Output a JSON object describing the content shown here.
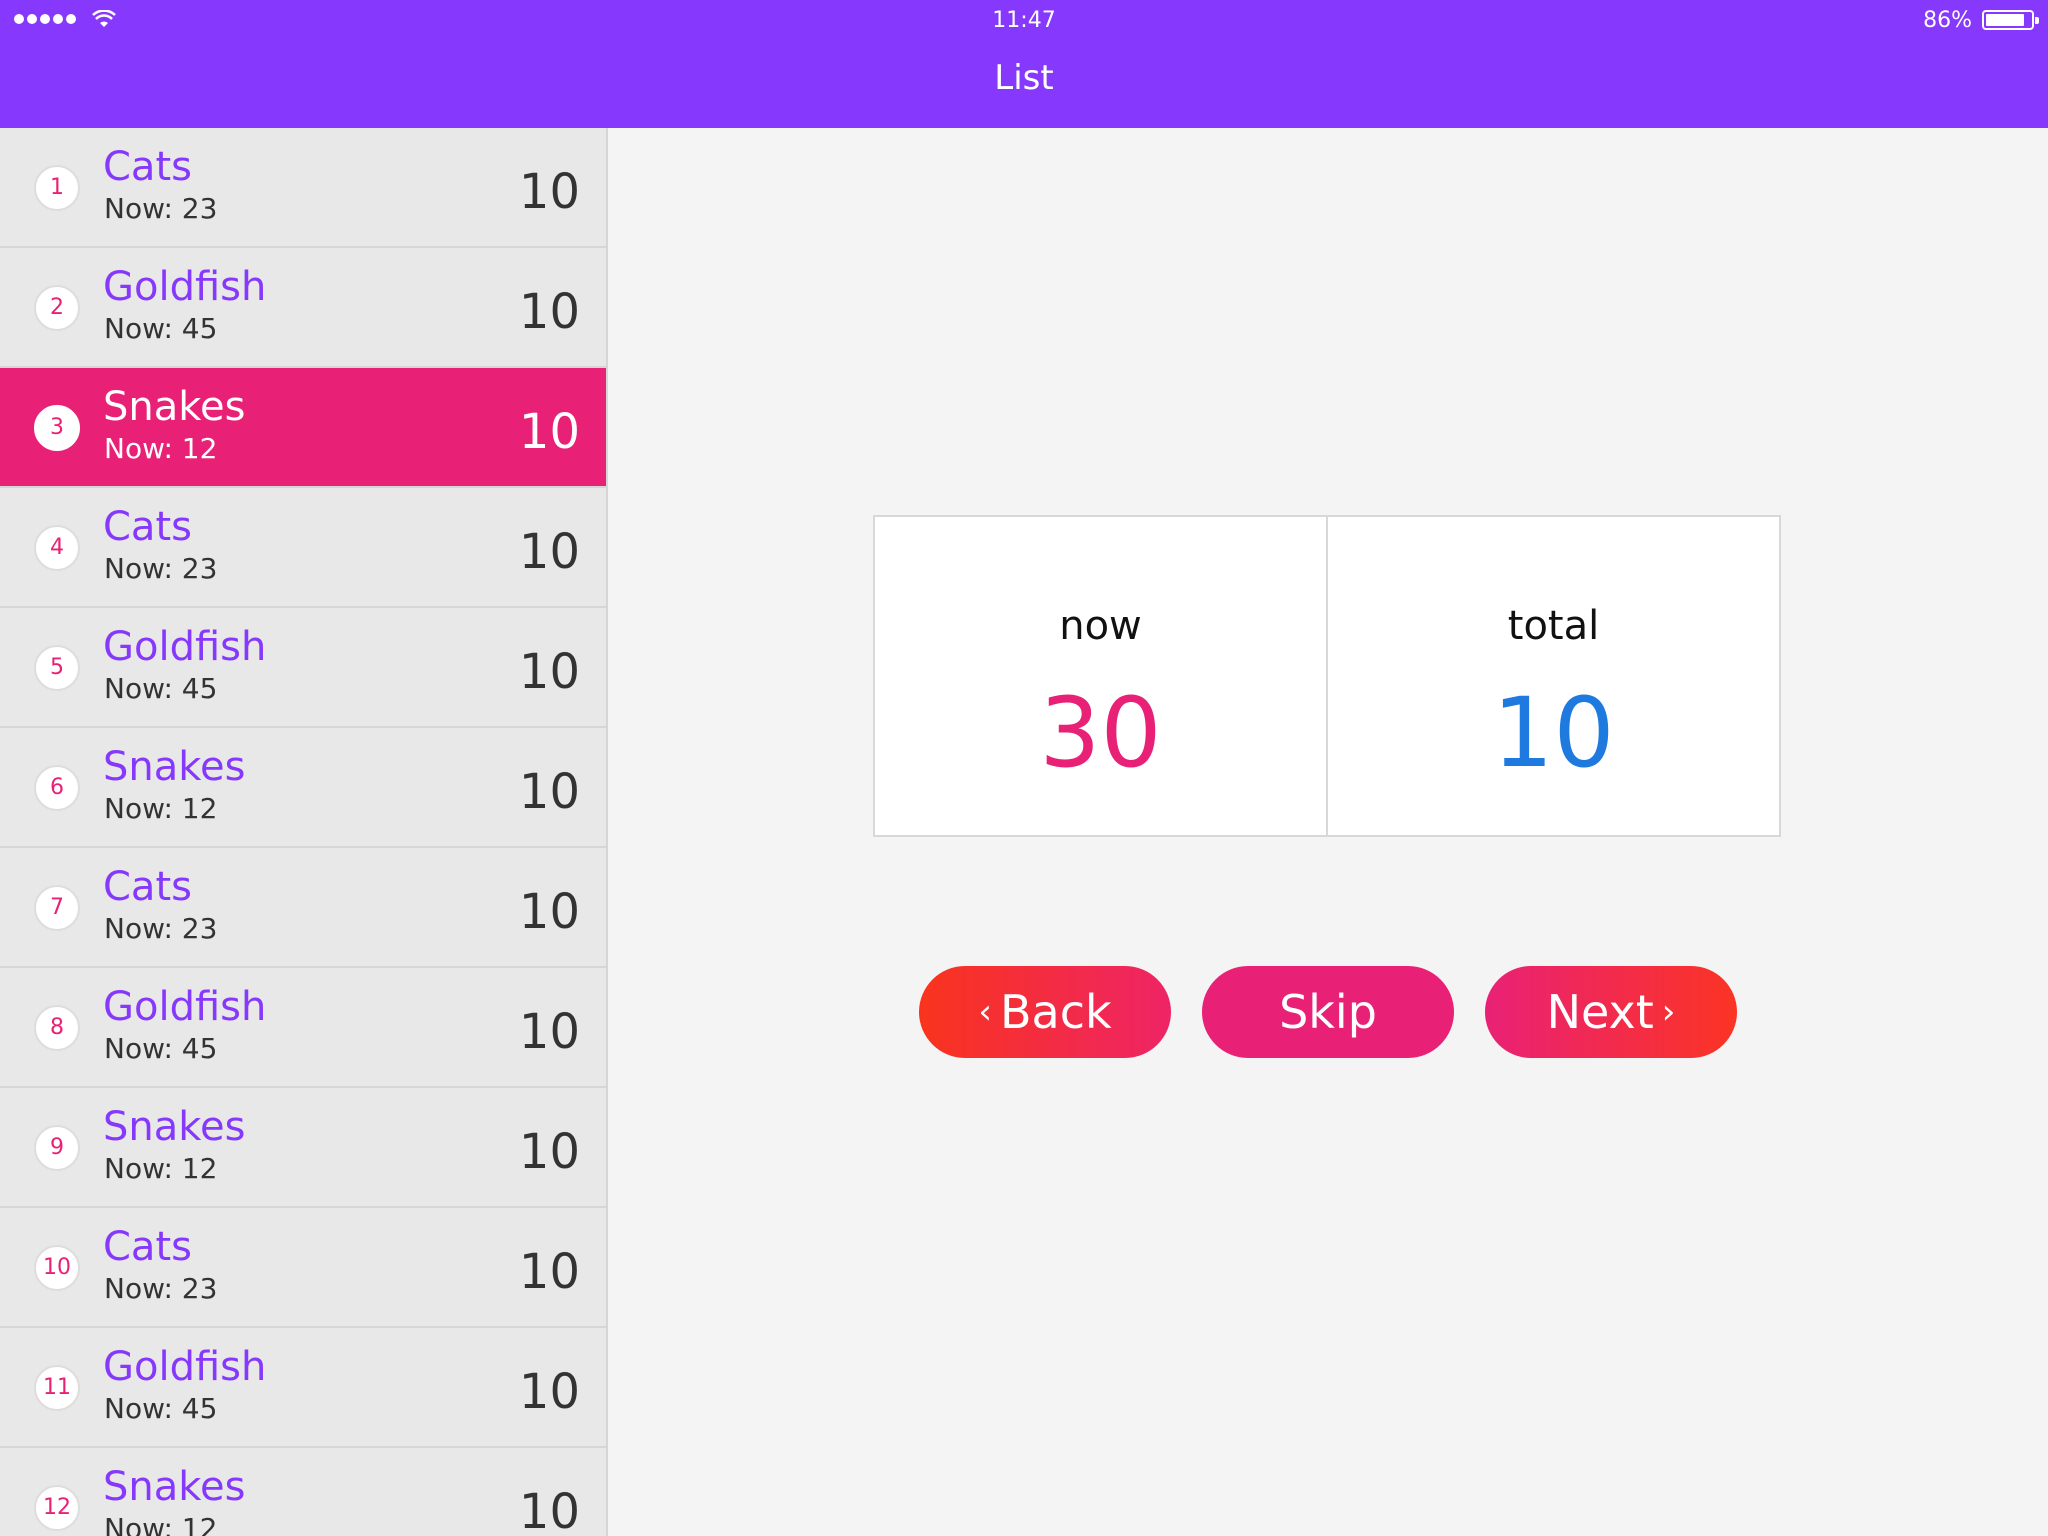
{
  "status": {
    "time": "11:47",
    "battery": "86%",
    "battery_level": 0.86
  },
  "nav": {
    "title": "List"
  },
  "list": [
    {
      "index": "1",
      "title": "Cats",
      "sub": "Now: 23",
      "value": "10"
    },
    {
      "index": "2",
      "title": "Goldfish",
      "sub": "Now: 45",
      "value": "10"
    },
    {
      "index": "3",
      "title": "Snakes",
      "sub": "Now: 12",
      "value": "10",
      "selected": true
    },
    {
      "index": "4",
      "title": "Cats",
      "sub": "Now: 23",
      "value": "10"
    },
    {
      "index": "5",
      "title": "Goldfish",
      "sub": "Now: 45",
      "value": "10"
    },
    {
      "index": "6",
      "title": "Snakes",
      "sub": "Now: 12",
      "value": "10"
    },
    {
      "index": "7",
      "title": "Cats",
      "sub": "Now: 23",
      "value": "10"
    },
    {
      "index": "8",
      "title": "Goldfish",
      "sub": "Now: 45",
      "value": "10"
    },
    {
      "index": "9",
      "title": "Snakes",
      "sub": "Now: 12",
      "value": "10"
    },
    {
      "index": "10",
      "title": "Cats",
      "sub": "Now: 23",
      "value": "10"
    },
    {
      "index": "11",
      "title": "Goldfish",
      "sub": "Now: 45",
      "value": "10"
    },
    {
      "index": "12",
      "title": "Snakes",
      "sub": "Now: 12",
      "value": "10"
    }
  ],
  "stats": {
    "now_label": "now",
    "now_value": "30",
    "total_label": "total",
    "total_value": "10"
  },
  "buttons": {
    "back": "Back",
    "skip": "Skip",
    "next": "Next"
  },
  "colors": {
    "header": "#8638fc",
    "accent": "#e92176",
    "total": "#1f7adf"
  }
}
